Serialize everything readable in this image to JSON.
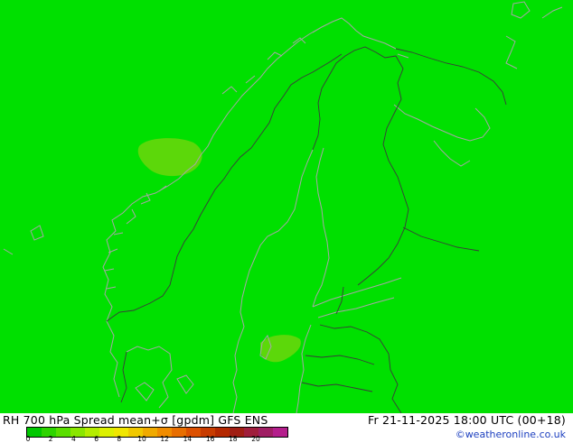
{
  "map": {
    "field_color": "#00e000",
    "patch_color": "#5cd80a",
    "coast_color": "#a6a6a6",
    "border_color": "#3a3a3a"
  },
  "footer": {
    "title": "RH 700 hPa Spread mean+σ [gpdm] GFS ENS",
    "datetime": "Fr 21-11-2025 18:00 UTC (00+18)",
    "credit": "©weatheronline.co.uk"
  },
  "colorbar": {
    "colors": [
      "#00c800",
      "#2ed400",
      "#5ade00",
      "#8ae600",
      "#b4ec00",
      "#dcf000",
      "#f0e600",
      "#f0c800",
      "#f0aa00",
      "#f08c00",
      "#e86e00",
      "#dc5000",
      "#c83c00",
      "#b42800",
      "#a01e14",
      "#a01e3c",
      "#a01e64",
      "#b41e8c"
    ],
    "tick_labels": [
      "0",
      "2",
      "4",
      "6",
      "8",
      "10",
      "12",
      "14",
      "16",
      "18",
      "20"
    ]
  }
}
